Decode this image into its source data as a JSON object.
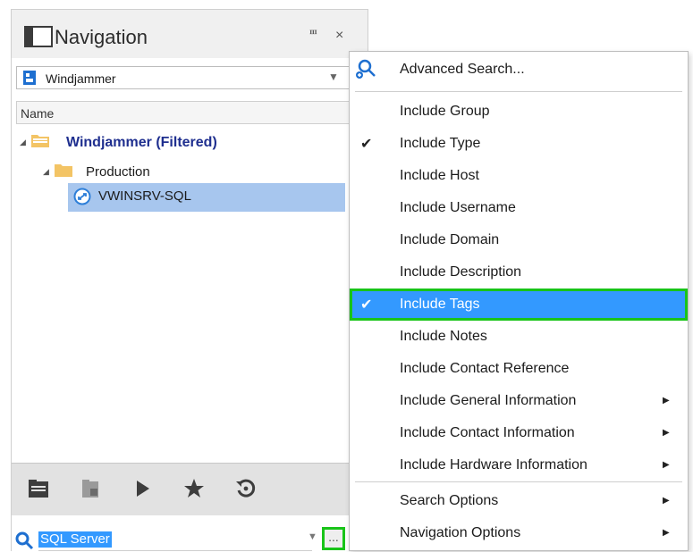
{
  "navigation": {
    "title": "Navigation",
    "pin_glyph": "ⱎ",
    "close_glyph": "×",
    "dataset": "Windjammer",
    "column_name": "Name",
    "tree": {
      "root": "Windjammer (Filtered)",
      "folder": "Production",
      "entry": "VWINSRV-SQL"
    },
    "search_value": "SQL Server",
    "more_glyph": "..."
  },
  "menu": {
    "advanced_search": "Advanced Search...",
    "items": [
      {
        "label": "Include Group",
        "checked": false,
        "submenu": false
      },
      {
        "label": "Include Type",
        "checked": true,
        "submenu": false
      },
      {
        "label": "Include Host",
        "checked": false,
        "submenu": false
      },
      {
        "label": "Include Username",
        "checked": false,
        "submenu": false
      },
      {
        "label": "Include Domain",
        "checked": false,
        "submenu": false
      },
      {
        "label": "Include Description",
        "checked": false,
        "submenu": false
      },
      {
        "label": "Include Tags",
        "checked": true,
        "submenu": false,
        "highlighted": true
      },
      {
        "label": "Include Notes",
        "checked": false,
        "submenu": false
      },
      {
        "label": "Include Contact Reference",
        "checked": false,
        "submenu": false
      },
      {
        "label": "Include General Information",
        "checked": false,
        "submenu": true
      },
      {
        "label": "Include Contact Information",
        "checked": false,
        "submenu": true
      },
      {
        "label": "Include Hardware Information",
        "checked": false,
        "submenu": true
      }
    ],
    "search_options": "Search Options",
    "navigation_options": "Navigation Options",
    "check_glyph": "✔",
    "submenu_glyph": "▶"
  },
  "colors": {
    "selection": "#3399ff",
    "highlight_outline": "#19c419",
    "tree_selected": "#a7c6ee",
    "root_text": "#1f2f8f",
    "folder": "#f3c465"
  },
  "icons": [
    "navigation-panel-icon",
    "pin-icon",
    "close-icon",
    "dataset-icon",
    "folder-icon",
    "connection-icon",
    "search-icon",
    "magnifier-advanced-icon",
    "check-icon",
    "submenu-arrow-icon",
    "navigation-tab-icon",
    "vault-tab-icon",
    "play-tab-icon",
    "favorites-star-icon",
    "history-icon"
  ]
}
